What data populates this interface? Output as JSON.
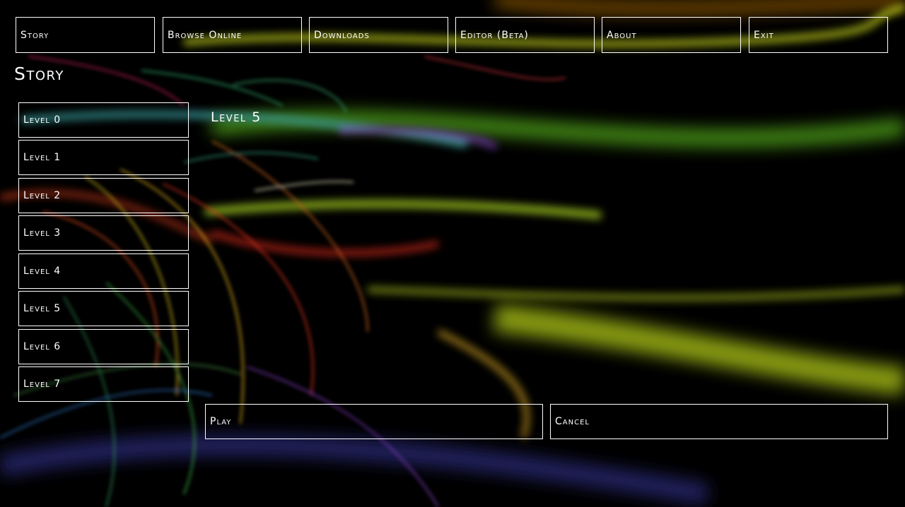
{
  "nav": {
    "items": [
      "Story",
      "Browse Online",
      "Downloads",
      "Editor (Beta)",
      "About",
      "Exit"
    ]
  },
  "page": {
    "title": "Story"
  },
  "levels": {
    "items": [
      "Level 0",
      "Level 1",
      "Level 2",
      "Level 3",
      "Level 4",
      "Level 5",
      "Level 6",
      "Level 7"
    ]
  },
  "selected": {
    "title": "Level 5"
  },
  "actions": {
    "play": "Play",
    "cancel": "Cancel"
  },
  "colors": {
    "background": "#000000",
    "border": "#ffffff",
    "text": "#ffffff"
  }
}
